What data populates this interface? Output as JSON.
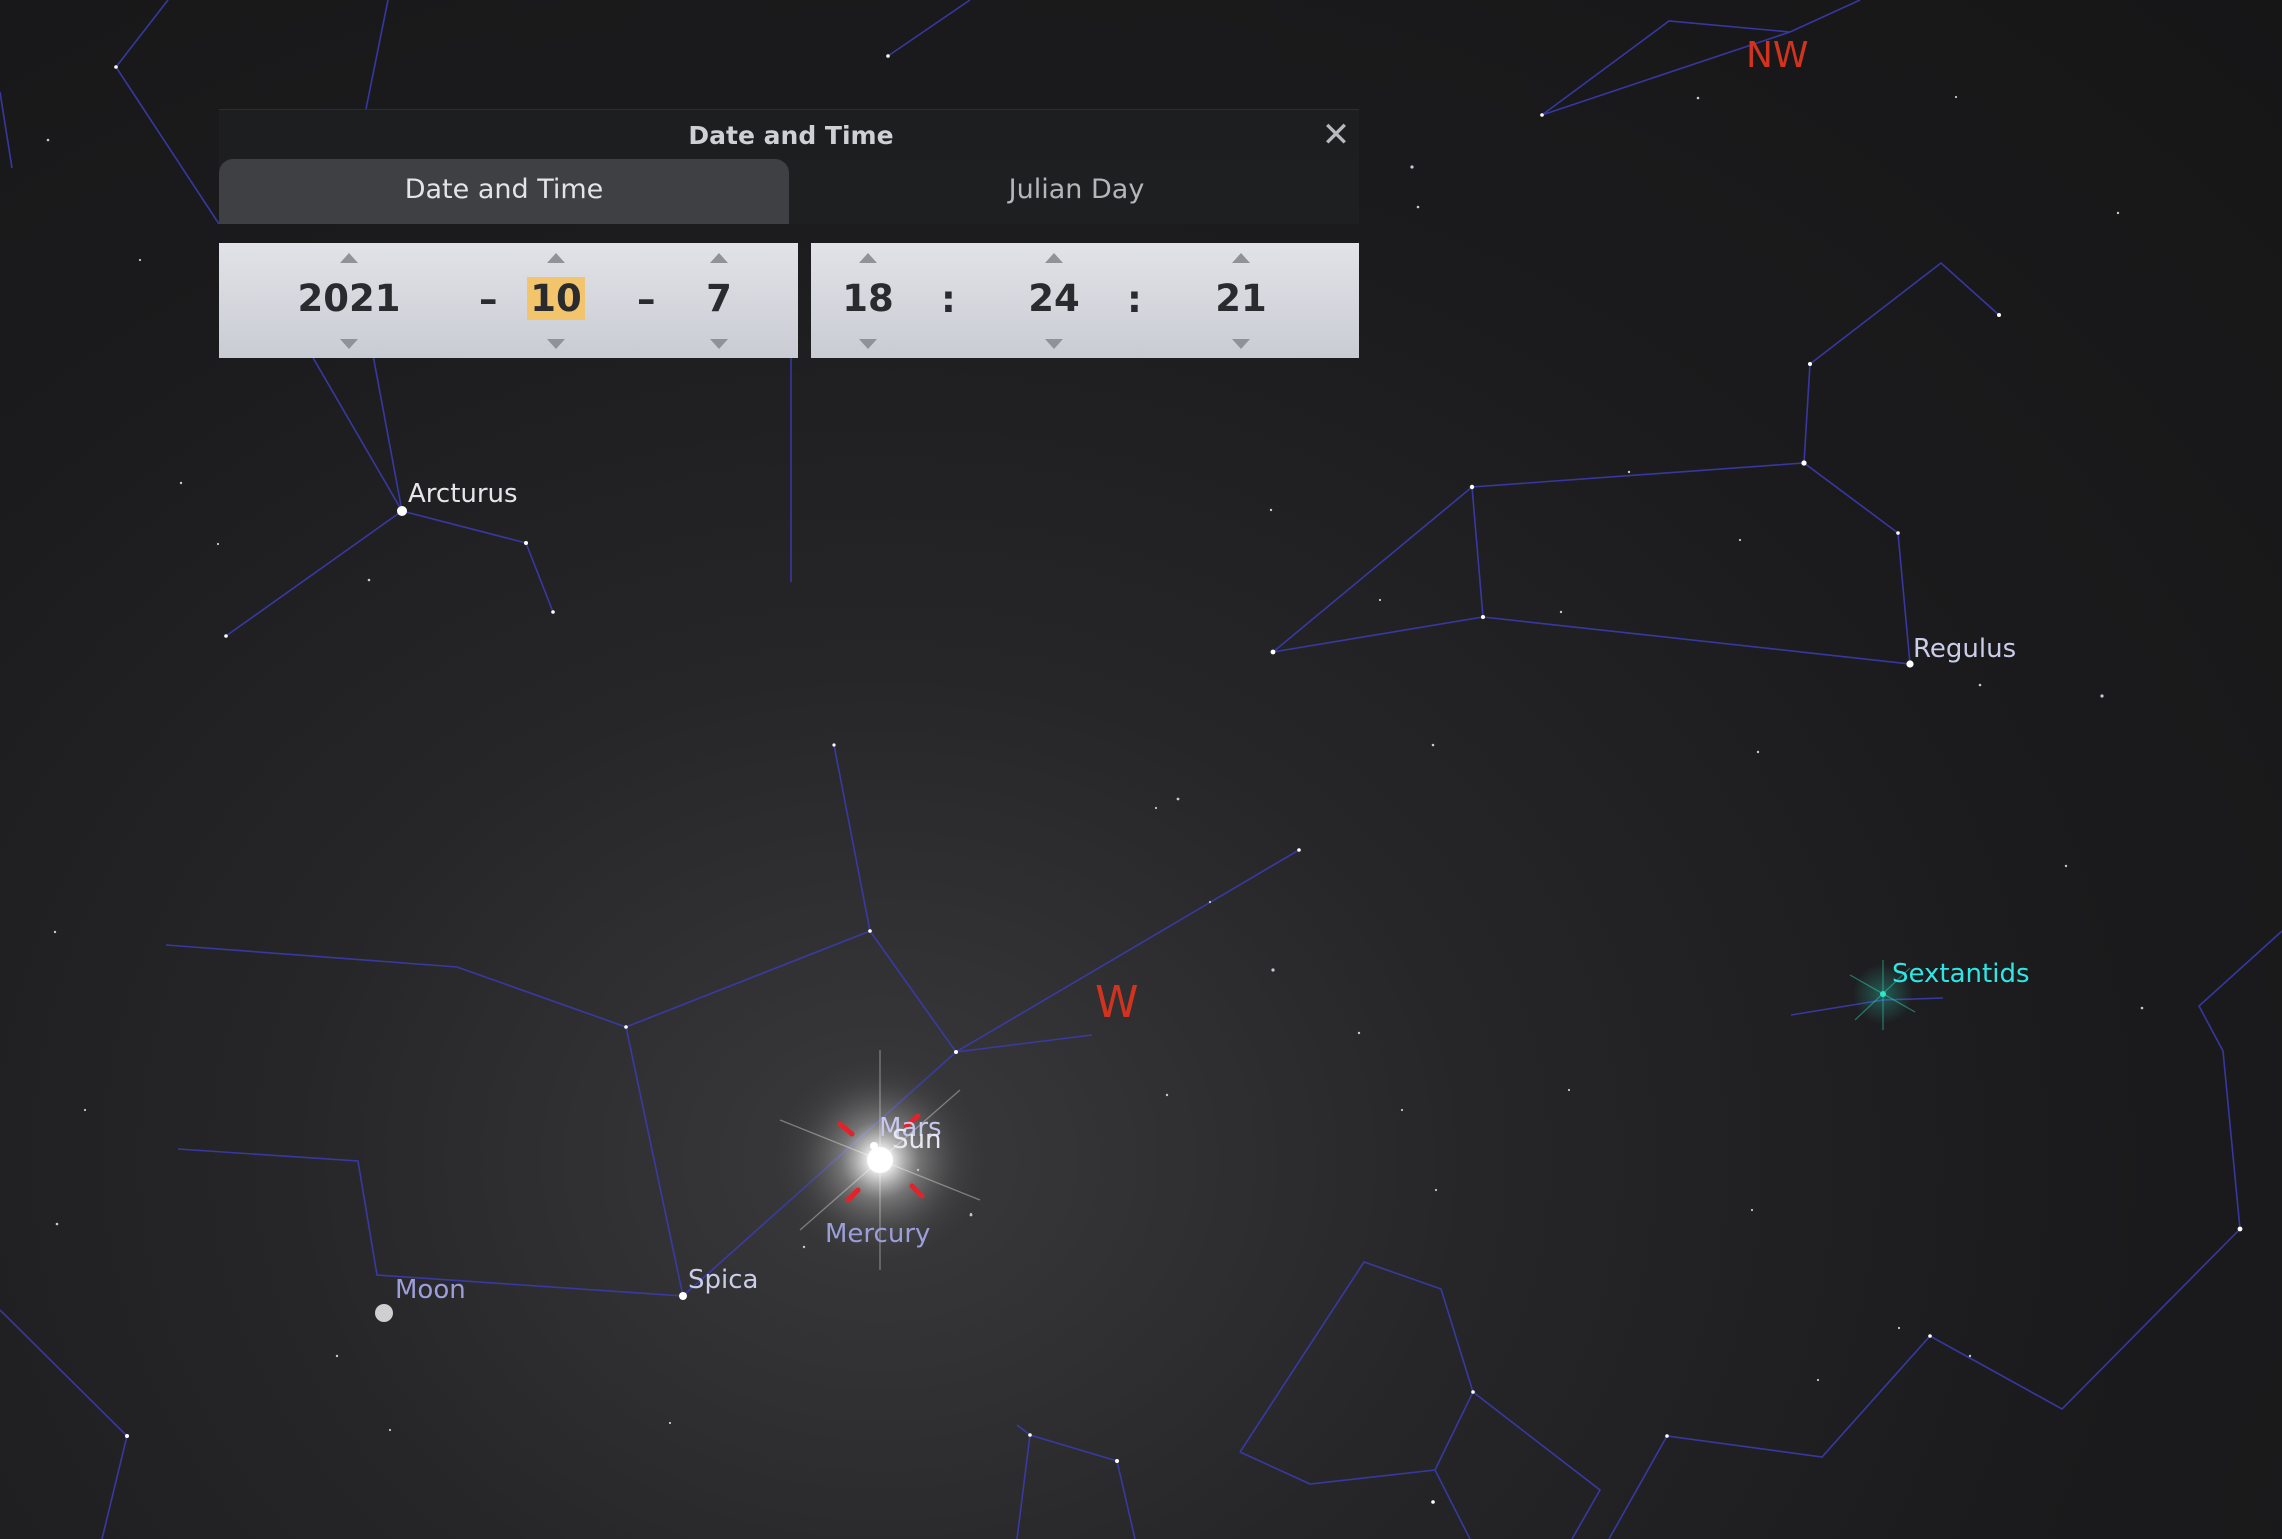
{
  "dialog": {
    "title": "Date and Time",
    "tabs": [
      {
        "label": "Date and Time",
        "active": true
      },
      {
        "label": "Julian Day",
        "active": false
      }
    ],
    "date": {
      "year": "2021",
      "month": "10",
      "day": "7",
      "separator": "–"
    },
    "time": {
      "hour": "18",
      "minute": "24",
      "second": "21",
      "separator": ":"
    },
    "close_icon": "close-icon"
  },
  "sky": {
    "stars": [
      "Arcturus",
      "Regulus",
      "Spica"
    ],
    "planets": [
      "Mars",
      "Sun",
      "Mercury",
      "Moon"
    ],
    "cardinals": [
      "NW",
      "W"
    ],
    "meteor_showers": [
      "Sextantids"
    ]
  },
  "colors": {
    "constellation_lines": "#3b3bb0",
    "cardinal": "#d1331f",
    "star_label": "#c9cde8",
    "planet_label": "#9c9ed9",
    "meteor_label": "#2ee6e6",
    "highlight": "#f2c56d"
  }
}
